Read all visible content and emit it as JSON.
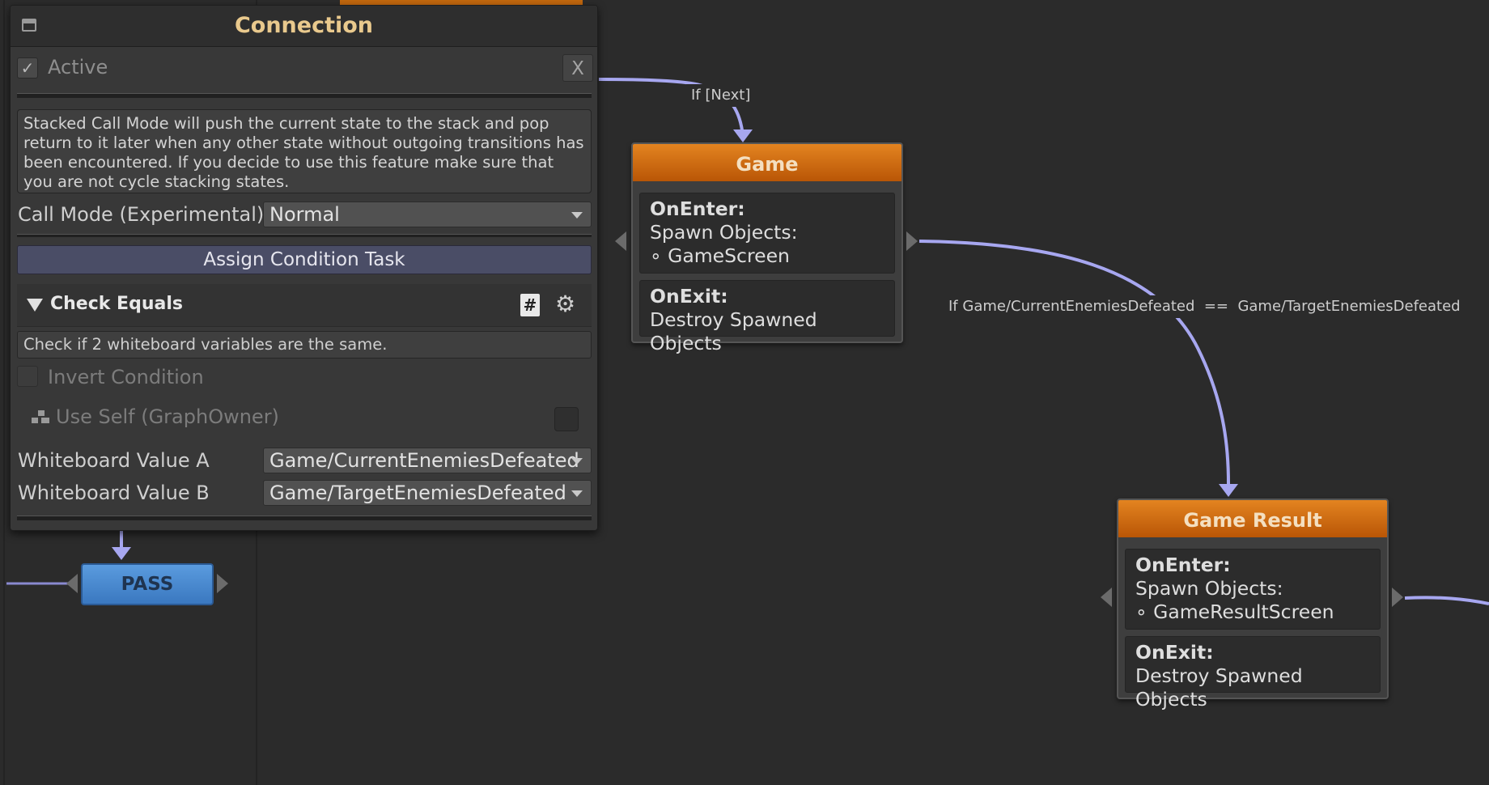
{
  "inspector": {
    "title": "Connection",
    "active_label": "Active",
    "close_label": "X",
    "help_text": "Stacked Call Mode will push the current state to the stack and pop return to it later when any other state without outgoing transitions has been encountered. If you decide to use this feature make sure that you are not cycle stacking states.",
    "call_mode_label": "Call Mode (Experimental)",
    "call_mode_value": "Normal",
    "assign_button": "Assign Condition Task",
    "task_title": "Check Equals",
    "hash_icon_glyph": "#",
    "task_description": "Check if 2 whiteboard variables are the same.",
    "invert_label": "Invert Condition",
    "use_self_label": "Use Self (GraphOwner)",
    "value_a_label": "Whiteboard Value A",
    "value_a": "Game/CurrentEnemiesDefeated",
    "value_b_label": "Whiteboard Value B",
    "value_b": "Game/TargetEnemiesDefeated"
  },
  "graph": {
    "transition_top_label": "If [Next]",
    "transition_mid_label": "If Game/CurrentEnemiesDefeated  ==  Game/TargetEnemiesDefeated",
    "game_node": {
      "title": "Game",
      "on_enter_header": "OnEnter:",
      "on_enter_line1": "Spawn Objects:",
      "on_enter_line2": "∘ GameScreen",
      "on_exit_header": "OnExit:",
      "on_exit_line1": "Destroy Spawned Objects"
    },
    "result_node": {
      "title": "Game Result",
      "on_enter_header": "OnEnter:",
      "on_enter_line1": "Spawn Objects:",
      "on_enter_line2": "∘ GameResultScreen",
      "on_exit_header": "OnExit:",
      "on_exit_line1": "Destroy Spawned Objects"
    },
    "pass_node": {
      "title": "PASS"
    }
  },
  "colors": {
    "accent_orange": "#e38420",
    "title_gold": "#e9c98d",
    "connection_purple": "#a7a7f0",
    "pass_blue": "#4a8bd0"
  }
}
